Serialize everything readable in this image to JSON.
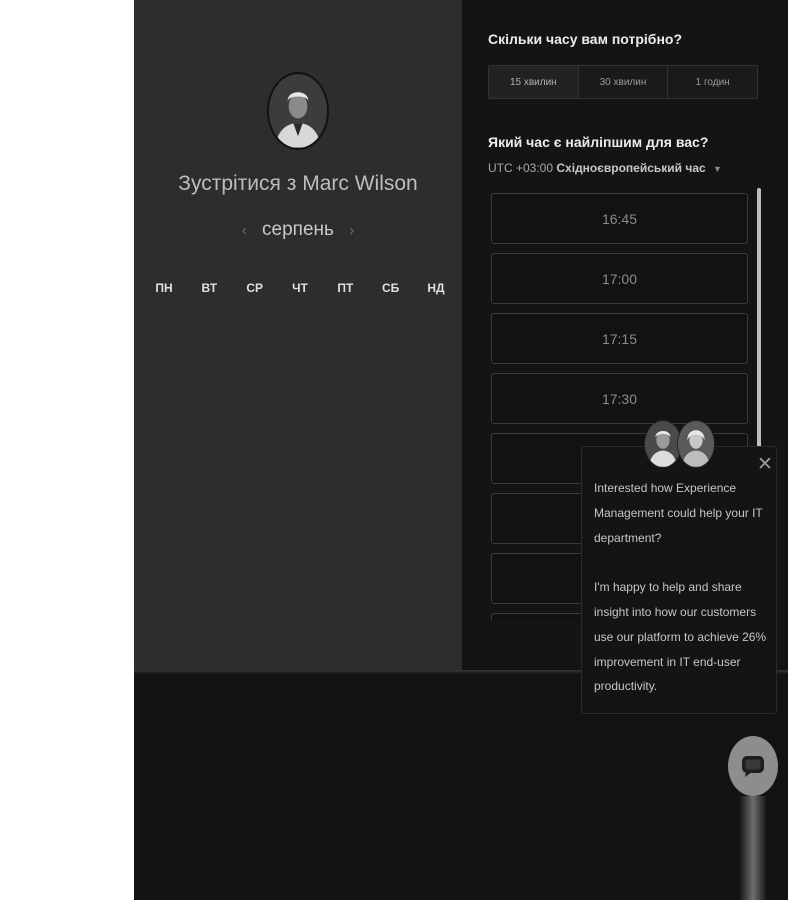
{
  "host": {
    "meet_prefix": "Зустрітися з",
    "name": "Marc Wilson"
  },
  "calendar": {
    "month": "серпень",
    "prev_arrow": "‹",
    "next_arrow": "›",
    "weekdays": [
      "ПН",
      "ВТ",
      "СР",
      "ЧТ",
      "ПТ",
      "СБ",
      "НД"
    ]
  },
  "duration": {
    "title": "Скільки часу вам потрібно?",
    "options": [
      "15 хвилин",
      "30 хвилин",
      "1 годин"
    ],
    "selected": "15 хвилин"
  },
  "time": {
    "title": "Який час є найліпшим для вас?",
    "timezone_offset": "UTC +03:00",
    "timezone_name": "Східноєвропейський час",
    "slots": [
      "16:45",
      "17:00",
      "17:15",
      "17:30",
      "",
      "",
      "",
      ""
    ]
  },
  "chat": {
    "message_1": "Interested how Experience Management could help your IT department?",
    "message_2": "I'm happy to help and share insight into how our customers use our platform to achieve 26% improvement in IT end-user productivity.",
    "close_icon": "close-icon",
    "launcher_icon": "chat-bubble-icon"
  },
  "colors": {
    "left_panel": "#2d2d2d",
    "right_panel": "#141414",
    "frame": "#121212",
    "launcher": "#8d8d8d"
  }
}
